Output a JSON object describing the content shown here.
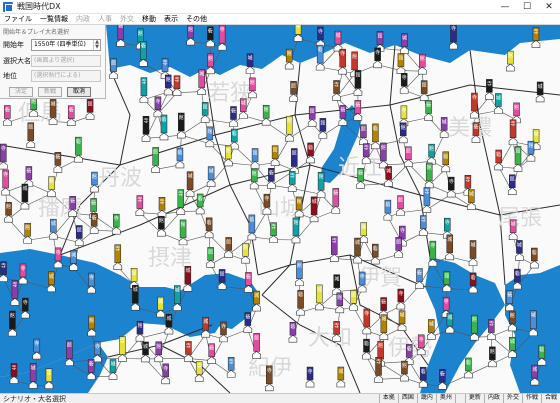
{
  "window": {
    "title": "戦国時代DX",
    "buttons": {
      "minimize": "—",
      "maximize": "☐",
      "close": "✕"
    }
  },
  "menu": [
    {
      "label": "ファイル",
      "enabled": true
    },
    {
      "label": "一覧情報",
      "enabled": true
    },
    {
      "label": "内政",
      "enabled": false
    },
    {
      "label": "人事",
      "enabled": false
    },
    {
      "label": "外交",
      "enabled": false
    },
    {
      "label": "移動",
      "enabled": true
    },
    {
      "label": "表示",
      "enabled": true
    },
    {
      "label": "その他",
      "enabled": true
    }
  ],
  "dialog": {
    "title": "開始年＆プレイ大名選択",
    "start_year_label": "開始年",
    "start_year_value": "1550年 (四季単位)",
    "daimyo_label": "選択大名",
    "daimyo_value": "(画面より選択)",
    "position_label": "地位",
    "position_value": "(選択執行による)",
    "buttons": {
      "confirm": "決定",
      "new_game": "新戦",
      "cancel": "取消"
    }
  },
  "map": {
    "province_names": [
      "若狭",
      "丹波",
      "摂津",
      "但馬",
      "播磨",
      "近江",
      "美濃",
      "伊勢",
      "大和",
      "伊賀",
      "紀伊",
      "山城",
      "尾張"
    ],
    "castle_kanji": [
      "城",
      "館",
      "砦",
      "寺"
    ],
    "colors": {
      "sea": "#1c83cf",
      "land": "#fafafa",
      "road": "#555555",
      "border": "#2a2a2a",
      "lake": "#1c83cf"
    },
    "clan_colors": [
      "#c0392b",
      "#8a0f1a",
      "#0fa1a3",
      "#b38300",
      "#8a3fa8",
      "#2b2b8a",
      "#e6e23a",
      "#1a1a1a",
      "#e14ba0",
      "#3bb34a",
      "#4a8ed9",
      "#7a4b25"
    ]
  },
  "status": {
    "text": "シナリオ・大名選択",
    "cells": [
      "本拠",
      "西国",
      "畿内",
      "奥州",
      "",
      "更新",
      "内政",
      "外交",
      "作戦",
      "合戦"
    ]
  }
}
